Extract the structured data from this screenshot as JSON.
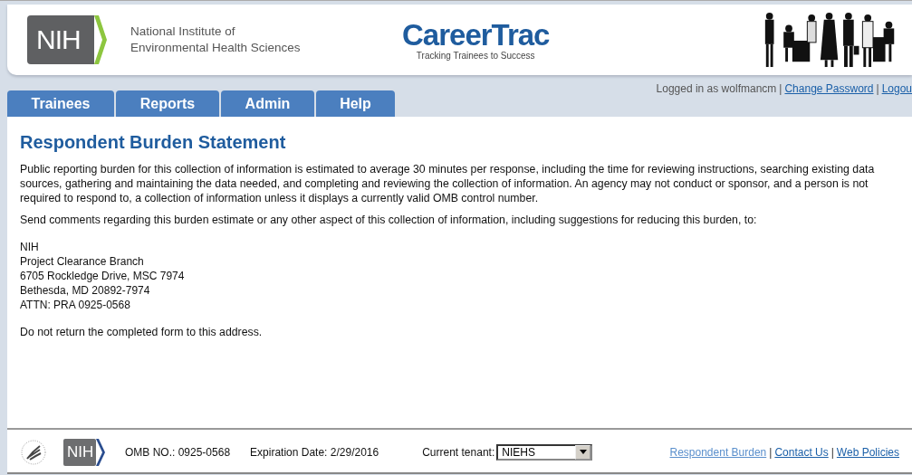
{
  "header": {
    "org_logo": "NIH",
    "org_name": [
      "National Institute of",
      "Environmental Health Sciences"
    ],
    "app_name": "CareerTrac",
    "app_tagline": "Tracking Trainees to Success"
  },
  "tabs": [
    {
      "label": "Trainees",
      "selected": false
    },
    {
      "label": "Reports",
      "selected": false
    },
    {
      "label": "Admin",
      "selected": false
    },
    {
      "label": "Help",
      "selected": false
    }
  ],
  "user_bar": {
    "logged_in": "Logged in as wolfmancm",
    "separator": "|",
    "links": [
      "Change Password",
      "Logou"
    ]
  },
  "page_title": "Respondent Burden Statement",
  "paragraphs": [
    "Public reporting burden for this collection of information is estimated to average 30 minutes per response, including the time for reviewing instructions, searching existing data sources, gathering and maintaining the data needed, and completing and reviewing the collection of information. An agency may not conduct or sponsor, and a person is not required to respond to, a collection of information unless it displays a currently valid OMB control number.",
    "Send comments regarding this burden estimate or any other aspect of this collection of information, including suggestions for reducing this burden, to:"
  ],
  "address": [
    "NIH",
    "Project Clearance Branch",
    "6705 Rockledge Drive, MSC 7974",
    "Bethesda, MD 20892-7974",
    "ATTN: PRA 0925-0568"
  ],
  "closing": "Do not return the completed form to this address.",
  "footer": {
    "logo": "NIH",
    "omb": "OMB NO.: 0925-0568",
    "expiration": "Expiration Date: 2/29/2016",
    "tenant_label": "Current tenant:",
    "tenant_value": "NIEHS",
    "separator": "|",
    "links": [
      "Respondent Burden",
      "Contact Us",
      "Web Policies"
    ]
  }
}
